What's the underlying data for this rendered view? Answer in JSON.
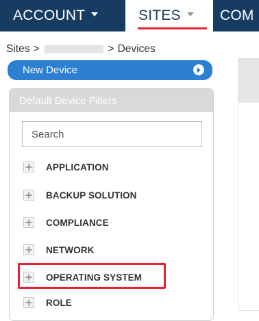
{
  "nav": {
    "account": "ACCOUNT",
    "sites": "SITES",
    "more": "COM"
  },
  "breadcrumb": {
    "root": "Sites",
    "separator": ">",
    "current": "Devices"
  },
  "new_device_button": "New Device",
  "filters": {
    "header": "Default Device Filters",
    "search_placeholder": "Search",
    "items": [
      {
        "label": "APPLICATION"
      },
      {
        "label": "BACKUP SOLUTION"
      },
      {
        "label": "COMPLIANCE"
      },
      {
        "label": "NETWORK"
      },
      {
        "label": "OPERATING SYSTEM",
        "highlighted": true
      },
      {
        "label": "ROLE"
      }
    ]
  },
  "colors": {
    "nav_bg": "#173c62",
    "accent_red": "#e3212f",
    "button_blue": "#2d7fd1"
  }
}
